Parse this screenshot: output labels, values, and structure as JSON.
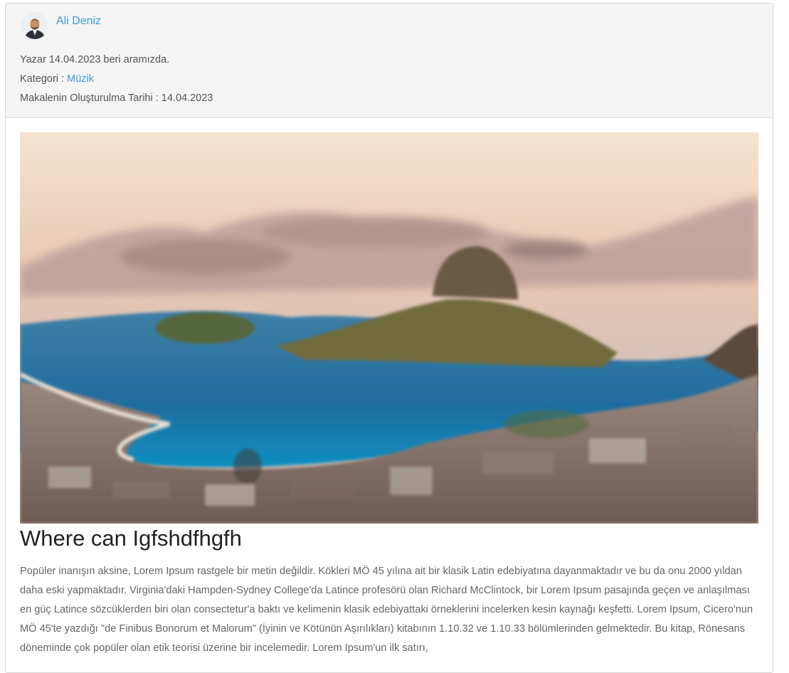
{
  "author": {
    "name": "Ali Deniz",
    "member_since_label": "Yazar 14.04.2023 beri aramızda."
  },
  "category": {
    "label": "Kategori :",
    "value": "Müzik"
  },
  "created": {
    "label": "Makalenin Oluşturulma Tarihi : 14.04.2023"
  },
  "article": {
    "title": "Where can Igfshdfhgfh",
    "paragraph": "Popüler inanışın aksine, Lorem Ipsum rastgele bir metin değildir. Kökleri MÖ 45 yılına ait bir klasik Latin edebiyatına dayanmaktadır ve bu da onu 2000 yıldan daha eski yapmaktadır. Virginia'daki Hampden-Sydney College'da Latince profesörü olan Richard McClintock, bir Lorem Ipsum pasajında geçen ve anlaşılması en güç Latince sözcüklerden biri olan consectetur'a baktı ve kelimenin klasik edebiyattaki örneklerini incelerken kesin kaynağı keşfetti. Lorem Ipsum, Cicero'nun MÖ 45'te yazdığı \"de Finibus Bonorum et Malorum\" (İyinin ve Kötünün Aşırılıkları) kitabının 1.10.32 ve 1.10.33 bölümlerinden gelmektedir. Bu kitap, Rönesans döneminde çok popüler olan etik teorisi üzerine bir incelemedir. Lorem Ipsum'un ilk satırı,"
  },
  "colors": {
    "link": "#3a9ad9",
    "header_bg": "#f5f5f5",
    "title": "#222222",
    "body_text": "#666666"
  },
  "icons": {
    "avatar": "author-avatar-photo",
    "hero": "coastal-city-photo"
  }
}
